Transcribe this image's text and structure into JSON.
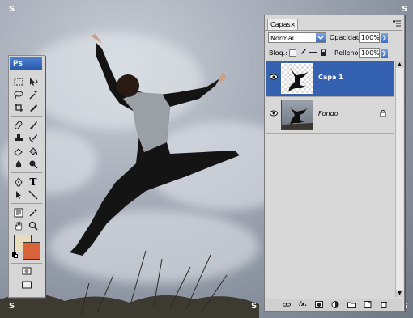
{
  "app": {
    "corner_marks": [
      "S",
      "S",
      "S",
      "S",
      "S"
    ]
  },
  "tools_panel": {
    "logo": "Ps",
    "tool_icons": [
      "marquee-icon",
      "move-icon",
      "lasso-icon",
      "magic-wand-icon",
      "crop-icon",
      "slice-icon",
      "healing-brush-icon",
      "brush-icon",
      "clone-stamp-icon",
      "history-brush-icon",
      "eraser-icon",
      "paint-bucket-icon",
      "blur-icon",
      "dodge-icon",
      "pen-icon",
      "type-icon",
      "path-selection-icon",
      "line-icon",
      "notes-icon",
      "eyedropper-icon",
      "hand-icon",
      "zoom-icon"
    ],
    "type_tool_glyph": "T",
    "foreground_color": "#e9dcbd",
    "background_color": "#d8623a"
  },
  "layers_panel": {
    "tab_label": "Capas",
    "tab_close": "×",
    "blend_mode": "Normal",
    "opacity_label": "Opacidad:",
    "opacity_value": "100%",
    "lock_label": "Bloq.:",
    "fill_label": "Relleno:",
    "fill_value": "100%",
    "layers": [
      {
        "name": "Capa 1",
        "selected": true
      },
      {
        "name": "Fondo",
        "selected": false
      }
    ],
    "bottom_icons": [
      "link-icon",
      "fx-icon",
      "mask-icon",
      "adjustment-icon",
      "group-icon",
      "new-layer-icon",
      "trash-icon"
    ],
    "fx_label": "fx."
  },
  "colors": {
    "selection_blue": "#3461b0",
    "panel_gray": "#d8d8d8"
  }
}
